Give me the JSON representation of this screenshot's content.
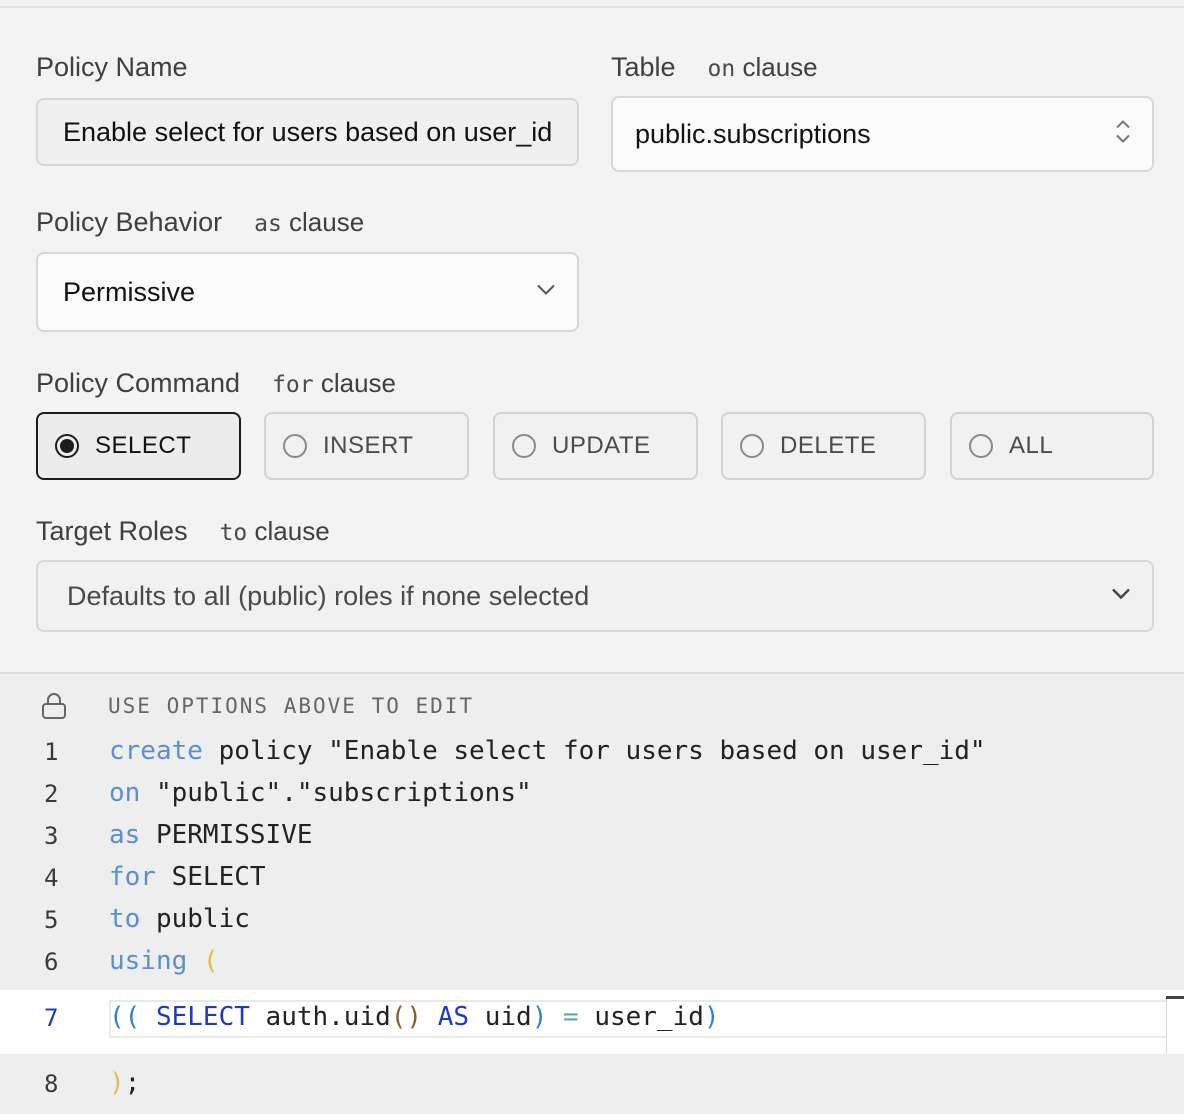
{
  "form": {
    "policy_name": {
      "label": "Policy Name",
      "value": "Enable select for users based on user_id"
    },
    "table": {
      "label": "Table",
      "clause_kw": "on",
      "clause_word": "clause",
      "value": "public.subscriptions"
    },
    "behavior": {
      "label": "Policy Behavior",
      "clause_kw": "as",
      "clause_word": "clause",
      "value": "Permissive"
    },
    "command": {
      "label": "Policy Command",
      "clause_kw": "for",
      "clause_word": "clause",
      "options": [
        "SELECT",
        "INSERT",
        "UPDATE",
        "DELETE",
        "ALL"
      ],
      "selected": "SELECT"
    },
    "roles": {
      "label": "Target Roles",
      "clause_kw": "to",
      "clause_word": "clause",
      "placeholder": "Defaults to all (public) roles if none selected"
    }
  },
  "editor": {
    "hint": "USE OPTIONS ABOVE TO EDIT",
    "line_numbers": [
      "1",
      "2",
      "3",
      "4",
      "5",
      "6",
      "7",
      "8"
    ],
    "l1": {
      "kw": "create",
      "rest": " policy \"Enable select for users based on user_id\""
    },
    "l2": {
      "kw": "on",
      "rest": " \"public\".\"subscriptions\""
    },
    "l3": {
      "kw": "as",
      "rest": " PERMISSIVE"
    },
    "l4": {
      "kw": "for",
      "rest": " SELECT"
    },
    "l5": {
      "kw": "to",
      "rest": " public"
    },
    "l6": {
      "kw": "using",
      "paren": "("
    },
    "l7": {
      "open": "((",
      "select": "SELECT",
      "fn": " auth.uid",
      "fn_parens": "()",
      "as": "AS",
      "alias": "uid",
      "close1": ")",
      "eq": "=",
      "rhs": "user_id",
      "close2": ")"
    },
    "l8": {
      "paren": ")",
      "semi": ";"
    }
  },
  "colors": {
    "keyword": "#5b8fd0",
    "sql_keyword": "#1d39c8",
    "paren_gold": "#e1c04a",
    "paren_blue": "#2f7fd6"
  }
}
